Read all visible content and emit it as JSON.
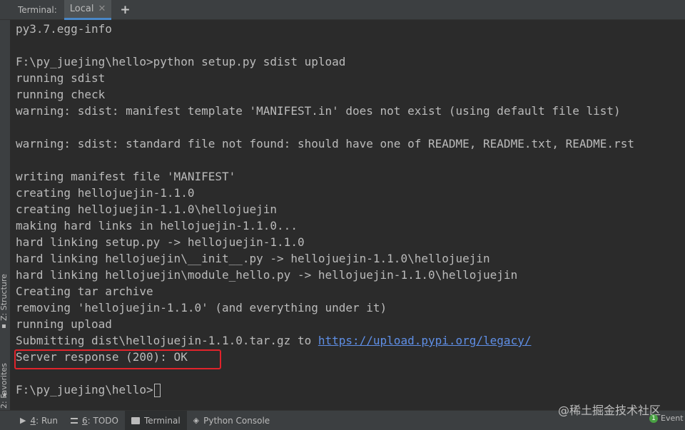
{
  "header": {
    "label": "Terminal:",
    "tab": {
      "label": "Local",
      "close_icon": "close-icon"
    },
    "new_tab_icon": "plus-icon"
  },
  "sidebar": {
    "items": [
      {
        "label": "Z: Structure",
        "icon": "structure-icon"
      },
      {
        "label": "2: Favorites",
        "icon": "star-icon"
      }
    ]
  },
  "terminal": {
    "lines": [
      "py3.7.egg-info",
      "",
      "F:\\py_juejing\\hello>python setup.py sdist upload",
      "running sdist",
      "running check",
      "warning: sdist: manifest template 'MANIFEST.in' does not exist (using default file list)",
      "",
      "warning: sdist: standard file not found: should have one of README, README.txt, README.rst",
      "",
      "writing manifest file 'MANIFEST'",
      "creating hellojuejin-1.1.0",
      "creating hellojuejin-1.1.0\\hellojuejin",
      "making hard links in hellojuejin-1.1.0...",
      "hard linking setup.py -> hellojuejin-1.1.0",
      "hard linking hellojuejin\\__init__.py -> hellojuejin-1.1.0\\hellojuejin",
      "hard linking hellojuejin\\module_hello.py -> hellojuejin-1.1.0\\hellojuejin",
      "Creating tar archive",
      "removing 'hellojuejin-1.1.0' (and everything under it)",
      "running upload"
    ],
    "submit_prefix": "Submitting dist\\hellojuejin-1.1.0.tar.gz to ",
    "submit_link": "https://upload.pypi.org/legacy/",
    "server_response": "Server response (200): OK",
    "blank": "",
    "prompt": "F:\\py_juejing\\hello>"
  },
  "footer": {
    "tabs": [
      {
        "hotkey": "4",
        "label": ": Run",
        "icon": "run-icon"
      },
      {
        "hotkey": "6",
        "label": ": TODO",
        "icon": "todo-icon"
      },
      {
        "hotkey": "",
        "label": "Terminal",
        "icon": "terminal-icon",
        "active": true
      },
      {
        "hotkey": "",
        "label": "Python Console",
        "icon": "python-console-icon"
      }
    ],
    "watermark": "@稀土掘金技术社区",
    "event_count": "1",
    "event_label": "Event"
  },
  "colors": {
    "background": "#2b2b2b",
    "panel": "#3c3f41",
    "text": "#bbbbbb",
    "link": "#5f8fe6",
    "highlight_border": "#e0232b",
    "badge": "#49a143"
  }
}
